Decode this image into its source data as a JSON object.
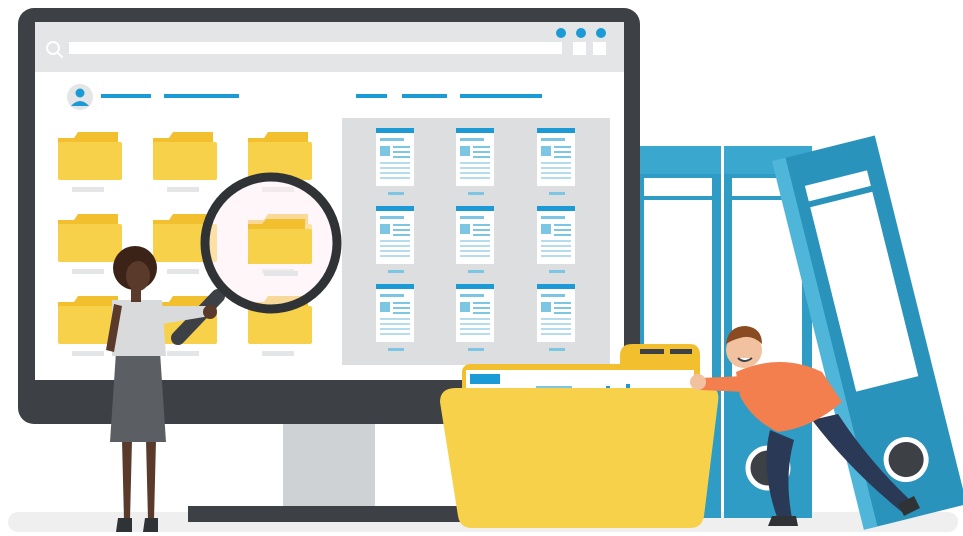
{
  "illustration": {
    "subject": "",
    "colors": {
      "monitor_bezel": "#3d4145",
      "screen_bg": "#ffffff",
      "toolbar_bg": "#e3e5e6",
      "panel_bg": "#dcdedf",
      "folder_yellow": "#f8d14a",
      "folder_back": "#f2bf2e",
      "accent_blue": "#1b9ad6",
      "binder_blue": "#2e9cc4",
      "binder_light": "#4fb6da",
      "shirt_orange": "#f47f4e",
      "pants_navy": "#2a3a56"
    },
    "icons": {
      "search": "search-icon",
      "window_dots": "window-control-dots",
      "user": "user-avatar-icon",
      "magnifier": "magnifying-glass-icon"
    }
  }
}
